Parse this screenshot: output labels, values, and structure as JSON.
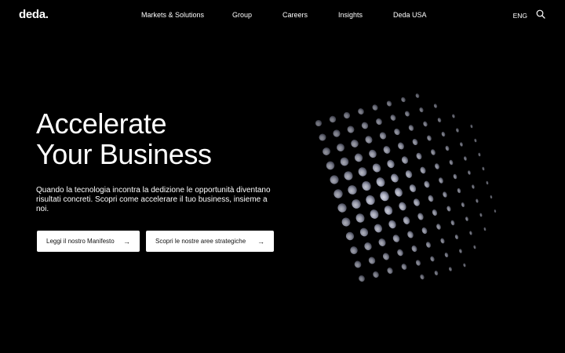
{
  "header": {
    "logo": "deda.",
    "nav": [
      {
        "label": "Markets & Solutions"
      },
      {
        "label": "Group"
      },
      {
        "label": "Careers"
      },
      {
        "label": "Insights"
      },
      {
        "label": "Deda USA"
      }
    ],
    "lang": "ENG",
    "search_icon": "search-icon"
  },
  "hero": {
    "title_line1": "Accelerate",
    "title_line2": "Your Business",
    "text": "Quando la tecnologia incontra la dedizione le opportunità diventano risultati concreti. Scopri come accelerare il tuo business, insieme a noi.",
    "buttons": [
      {
        "label": "Leggi il nostro Manifesto",
        "icon": "arrow-right-icon"
      },
      {
        "label": "Scopri le nostre aree strategiche",
        "icon": "arrow-right-icon"
      }
    ]
  },
  "colors": {
    "background": "#000000",
    "text": "#ffffff",
    "button_bg": "#ffffff",
    "button_text": "#111111",
    "dots": "#c8cad8"
  }
}
